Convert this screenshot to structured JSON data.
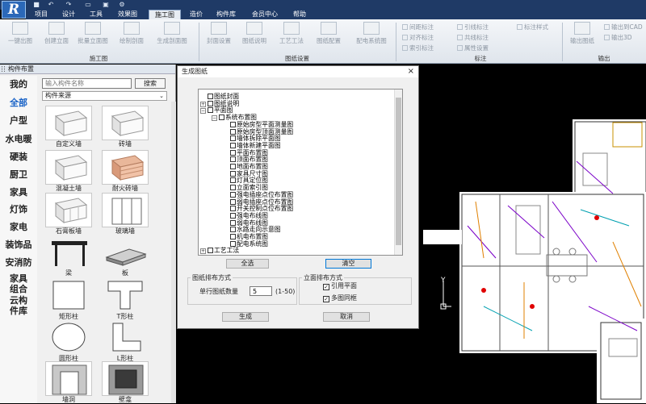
{
  "app": {
    "logo": "R"
  },
  "menu": {
    "tabs": [
      "项目",
      "设计",
      "工具",
      "效果图",
      "施工图",
      "造价",
      "构件库",
      "会员中心",
      "帮助"
    ],
    "active_tab": "施工图"
  },
  "ribbon": {
    "group1": {
      "title": "施工图",
      "buttons": [
        "一键出图",
        "创建立面",
        "批量立面图",
        "绘制剖面",
        "生成剖面图"
      ]
    },
    "group2": {
      "title": "图纸设置",
      "buttons": [
        "封面设置",
        "图纸说明",
        "工艺工法",
        "图纸配置",
        "配电系统图"
      ]
    },
    "group3": {
      "title": "标注",
      "items": [
        "间距标注",
        "对齐标注",
        "索引标注",
        "引线标注",
        "共线标注",
        "属性设置",
        "标注样式"
      ]
    },
    "group4": {
      "title": "输出",
      "buttons": [
        "输出图纸",
        "输出到CAD",
        "输出3D"
      ]
    }
  },
  "left_panel": {
    "title": "构件布置",
    "categories": [
      "我的",
      "全部",
      "户型",
      "水电暖",
      "硬装",
      "厨卫",
      "家具",
      "灯饰",
      "家电",
      "装饰品",
      "安消防",
      "家具组合",
      "云构件库"
    ],
    "active_category": "全部",
    "search": {
      "placeholder": "输入构件名称",
      "button": "搜索"
    },
    "source_select": "构件来源",
    "tiles": [
      "自定义墙",
      "砖墙",
      "混凝土墙",
      "耐火砖墙",
      "石膏板墙",
      "玻璃墙",
      "梁",
      "板",
      "矩形柱",
      "T形柱",
      "圆形柱",
      "L形柱",
      "墙洞",
      "壁龛"
    ]
  },
  "dialog": {
    "title": "生成图纸",
    "close": "×",
    "tree": [
      {
        "label": "图纸封面",
        "level": 0,
        "expander": ""
      },
      {
        "label": "图纸说明",
        "level": 0,
        "expander": "+"
      },
      {
        "label": "平面图",
        "level": 0,
        "expander": "−"
      },
      {
        "label": "系统布置图",
        "level": 1,
        "expander": "−"
      },
      {
        "label": "原始房型平面测量图",
        "level": 2,
        "expander": ""
      },
      {
        "label": "原始房型顶面测量图",
        "level": 2,
        "expander": ""
      },
      {
        "label": "墙体拆除平面图",
        "level": 2,
        "expander": ""
      },
      {
        "label": "墙体新建平面图",
        "level": 2,
        "expander": ""
      },
      {
        "label": "平面布置图",
        "level": 2,
        "expander": ""
      },
      {
        "label": "顶面布置图",
        "level": 2,
        "expander": ""
      },
      {
        "label": "地面布置图",
        "level": 2,
        "expander": ""
      },
      {
        "label": "家具尺寸图",
        "level": 2,
        "expander": ""
      },
      {
        "label": "灯具定位图",
        "level": 2,
        "expander": ""
      },
      {
        "label": "立面索引图",
        "level": 2,
        "expander": ""
      },
      {
        "label": "强电插座点位布置图",
        "level": 2,
        "expander": ""
      },
      {
        "label": "弱电插座点位布置图",
        "level": 2,
        "expander": ""
      },
      {
        "label": "开关控制点位布置图",
        "level": 2,
        "expander": ""
      },
      {
        "label": "强电布线图",
        "level": 2,
        "expander": ""
      },
      {
        "label": "弱电布线图",
        "level": 2,
        "expander": ""
      },
      {
        "label": "水路走向示意图",
        "level": 2,
        "expander": ""
      },
      {
        "label": "机电布置图",
        "level": 2,
        "expander": ""
      },
      {
        "label": "配电系统图",
        "level": 2,
        "expander": ""
      },
      {
        "label": "工艺工法",
        "level": 0,
        "expander": "+"
      }
    ],
    "select_all": "全选",
    "clear": "清空",
    "layout_group": {
      "title": "图纸排布方式",
      "count_label": "单行图纸数量",
      "count_value": "5",
      "range": "(1-50)"
    },
    "elevation_group": {
      "title": "立面排布方式",
      "opt1": "引用平面",
      "opt2": "多图同框",
      "opt1_checked": true,
      "opt2_checked": true
    },
    "generate": "生成",
    "cancel": "取消"
  }
}
